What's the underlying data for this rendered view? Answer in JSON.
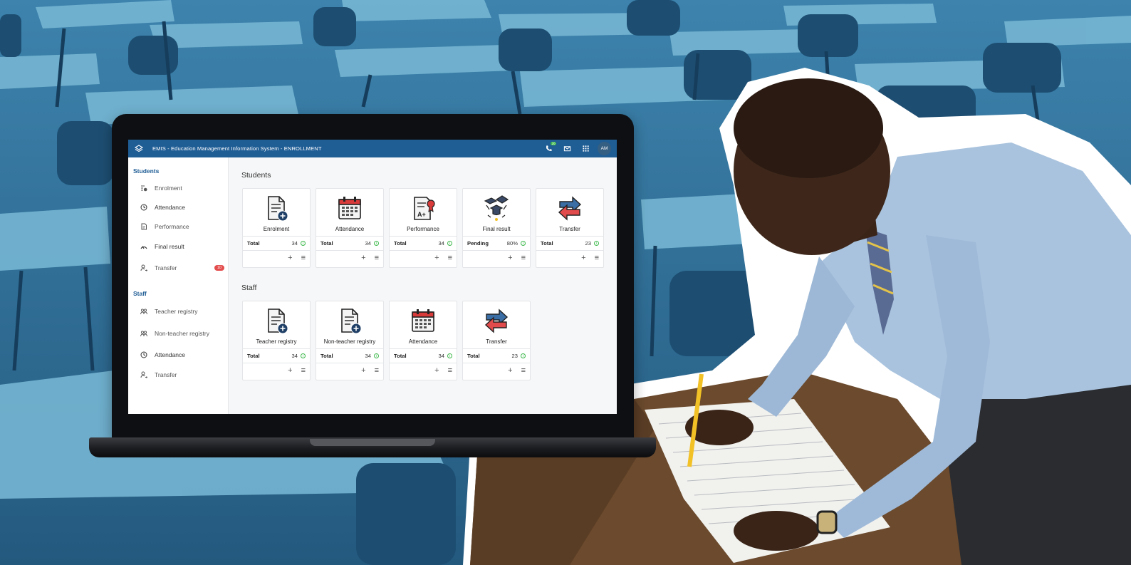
{
  "app": {
    "title": "EMIS - Education Management Information System - ENROLLMENT",
    "notification_count": "20",
    "avatar_initials": "AM",
    "accent_color": "#1f5d95"
  },
  "sidebar": {
    "students_heading": "Students",
    "student_items": [
      {
        "label": "Enrolment",
        "icon": "enrolment-icon"
      },
      {
        "label": "Attendance",
        "icon": "clock-icon"
      },
      {
        "label": "Performance",
        "icon": "document-icon"
      },
      {
        "label": "Final result",
        "icon": "gauge-icon"
      },
      {
        "label": "Transfer",
        "icon": "user-transfer-icon",
        "badge": "10"
      }
    ],
    "staff_heading": "Staff",
    "staff_items": [
      {
        "label": "Teacher registry",
        "icon": "group-icon"
      },
      {
        "label": "Non-teacher registry",
        "icon": "group-icon"
      },
      {
        "label": "Attendance",
        "icon": "clock-icon"
      },
      {
        "label": "Transfer",
        "icon": "user-transfer-icon"
      }
    ]
  },
  "main": {
    "students_title": "Students",
    "student_cards": [
      {
        "name": "Enrolment",
        "key": "Total",
        "value": "34",
        "icon": "document-add-icon"
      },
      {
        "name": "Attendance",
        "key": "Total",
        "value": "34",
        "icon": "calendar-icon"
      },
      {
        "name": "Performance",
        "key": "Total",
        "value": "34",
        "icon": "certificate-icon"
      },
      {
        "name": "Final result",
        "key": "Pending",
        "value": "80%",
        "icon": "graduation-icon"
      },
      {
        "name": "Transfer",
        "key": "Total",
        "value": "23",
        "icon": "transfer-arrows-icon"
      }
    ],
    "staff_title": "Staff",
    "staff_cards": [
      {
        "name": "Teacher registry",
        "key": "Total",
        "value": "34",
        "icon": "document-add-icon"
      },
      {
        "name": "Non-teacher registry",
        "key": "Total",
        "value": "34",
        "icon": "document-add-icon"
      },
      {
        "name": "Attendance",
        "key": "Total",
        "value": "34",
        "icon": "calendar-icon"
      },
      {
        "name": "Transfer",
        "key": "Total",
        "value": "23",
        "icon": "transfer-arrows-icon"
      }
    ],
    "add_symbol": "+",
    "menu_symbol": "≡",
    "info_symbol": "i"
  }
}
